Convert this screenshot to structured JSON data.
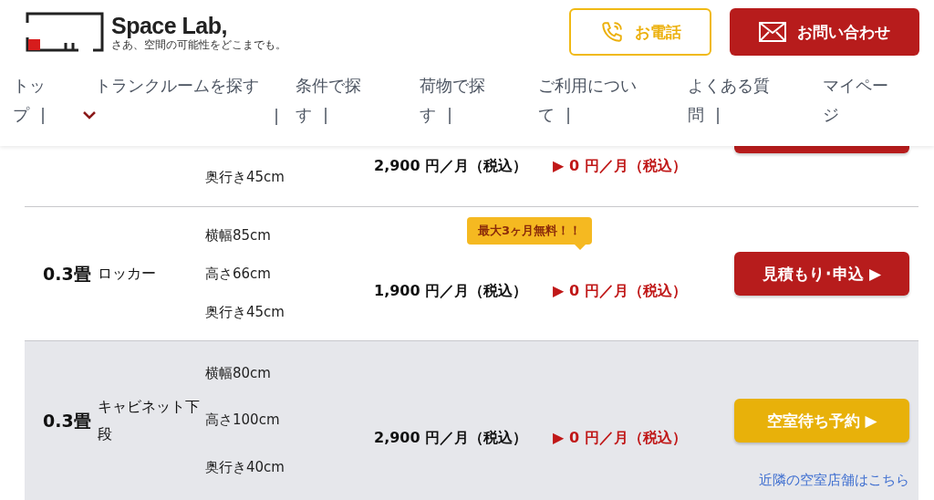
{
  "header": {
    "logo": {
      "name": "Space Lab,",
      "tagline": "さあ、空間の可能性をどこまでも。"
    },
    "buttons": [
      {
        "kind": "phone",
        "label": "お電話"
      },
      {
        "kind": "mail",
        "label": "お問い合わせ"
      }
    ]
  },
  "nav": [
    {
      "label": "トップ",
      "separator": "|",
      "dropdown": false
    },
    {
      "label": "トランクルームを探す",
      "separator": "|",
      "dropdown": true
    },
    {
      "label": "条件で探す",
      "separator": "|",
      "dropdown": false
    },
    {
      "label": "荷物で探す",
      "separator": "|",
      "dropdown": false
    },
    {
      "label": "ご利用について",
      "separator": "|",
      "dropdown": false
    },
    {
      "label": "よくある質問",
      "separator": "|",
      "dropdown": false
    },
    {
      "label": "マイページ",
      "dropdown": false
    }
  ],
  "rows": [
    {
      "kind": "cut",
      "shaded": false,
      "dims": [
        "奥行き45cm"
      ],
      "price": "2,900 円／月（税込）",
      "discount": "▶ 0 円／月（税込）",
      "action": {
        "kind": "apply"
      }
    },
    {
      "kind": "full",
      "shaded": false,
      "size": "0.3畳",
      "type": "ロッカー",
      "dims": [
        "横幅85cm",
        "高さ66cm",
        "奥行き45cm"
      ],
      "badge": "最大3ヶ月無料！！",
      "price": "1,900 円／月（税込）",
      "discount": "▶ 0 円／月（税込）",
      "action": {
        "kind": "apply",
        "label": "見積もり･申込 ▶"
      }
    },
    {
      "kind": "full",
      "shaded": true,
      "size": "0.3畳",
      "type": "キャビネット下段",
      "dims": [
        "横幅80cm",
        "高さ100cm",
        "奥行き40cm"
      ],
      "price": "2,900 円／月（税込）",
      "discount": "▶ 0 円／月（税込）",
      "action": {
        "kind": "wait",
        "label": "空室待ち予約 ▶"
      },
      "link": "近隣の空室店舗はこちら"
    }
  ]
}
